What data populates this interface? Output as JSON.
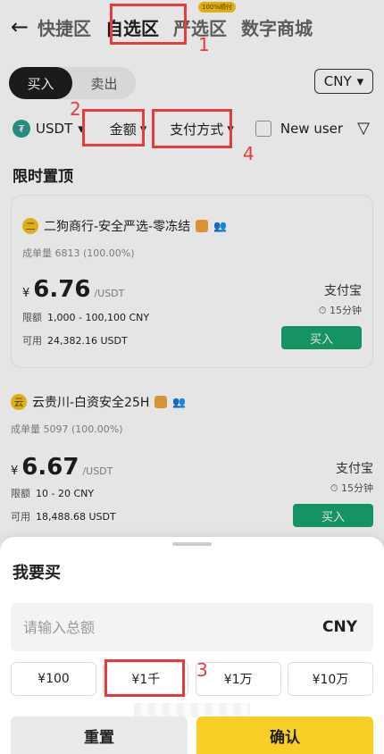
{
  "header": {
    "tabs": [
      {
        "label": "快捷区"
      },
      {
        "label": "自选区"
      },
      {
        "label": "严选区",
        "badge": "100%顺付"
      },
      {
        "label": "数字商城"
      }
    ]
  },
  "trade": {
    "buy_label": "买入",
    "sell_label": "卖出",
    "currency": "CNY"
  },
  "filters": {
    "asset": "USDT",
    "amount": "金额",
    "payment": "支付方式",
    "new_user": "New user"
  },
  "list": {
    "section_title": "限时置顶",
    "cards": [
      {
        "avatar": "二",
        "name": "二狗商行-安全严选-零冻结",
        "orders_label": "成单量",
        "orders": "6813 (100.00%)",
        "currency_symbol": "¥",
        "price": "6.76",
        "unit": "/USDT",
        "limit_label": "限额",
        "limit": "1,000 - 100,100 CNY",
        "available_label": "可用",
        "available": "24,382.16 USDT",
        "payment": "支付宝",
        "time": "15分钟",
        "buy": "买入"
      },
      {
        "avatar": "云",
        "name": "云贵川-白资安全25H",
        "orders_label": "成单量",
        "orders": "5097 (100.00%)",
        "currency_symbol": "¥",
        "price": "6.67",
        "unit": "/USDT",
        "limit_label": "限额",
        "limit": "10 - 20 CNY",
        "available_label": "可用",
        "available": "18,488.68 USDT",
        "payment": "支付宝",
        "time": "15分钟",
        "buy": "买入"
      }
    ]
  },
  "sheet": {
    "title": "我要买",
    "input_placeholder": "请输入总额",
    "input_currency": "CNY",
    "chips": [
      "¥100",
      "¥1千",
      "¥1万",
      "¥10万"
    ],
    "reset": "重置",
    "confirm": "确认"
  },
  "annotations": [
    "1",
    "2",
    "3",
    "4"
  ]
}
